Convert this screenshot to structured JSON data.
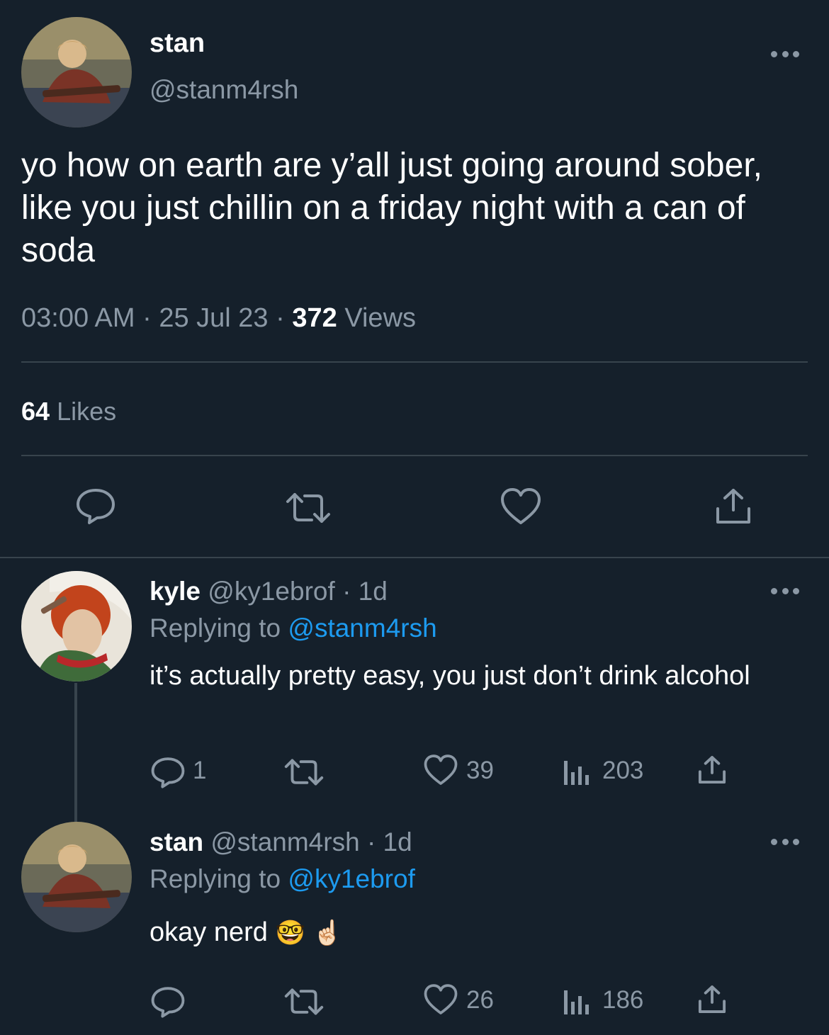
{
  "colors": {
    "background": "#15202b",
    "text": "#ffffff",
    "muted": "#8b98a5",
    "link": "#1d9bf0",
    "divider": "#38444d"
  },
  "main_tweet": {
    "name": "stan",
    "handle": "@stanm4rsh",
    "text": "yo how on earth are y’all just going around sober, like you just chillin on a friday night with a can of soda",
    "time": "03:00 AM",
    "date": "25 Jul 23",
    "views_count": "372",
    "views_label": "Views",
    "likes_count": "64",
    "likes_label": "Likes",
    "actions": [
      "reply-icon",
      "retweet-icon",
      "heart-icon",
      "share-icon"
    ]
  },
  "replies": [
    {
      "name": "kyle",
      "handle": "@ky1ebrof",
      "age": "· 1d",
      "replying_prefix": "Replying to",
      "replying_to": "@stanm4rsh",
      "text": "it’s actually pretty easy, you just don’t drink alcohol",
      "reply_count": "1",
      "like_count": "39",
      "view_count": "203"
    },
    {
      "name": "stan",
      "handle": "@stanm4rsh",
      "age": "· 1d",
      "replying_prefix": "Replying to",
      "replying_to": "@ky1ebrof",
      "text": "okay nerd",
      "emojis": [
        "🤓",
        "☝🏻"
      ],
      "like_count": "26",
      "view_count": "186"
    }
  ]
}
